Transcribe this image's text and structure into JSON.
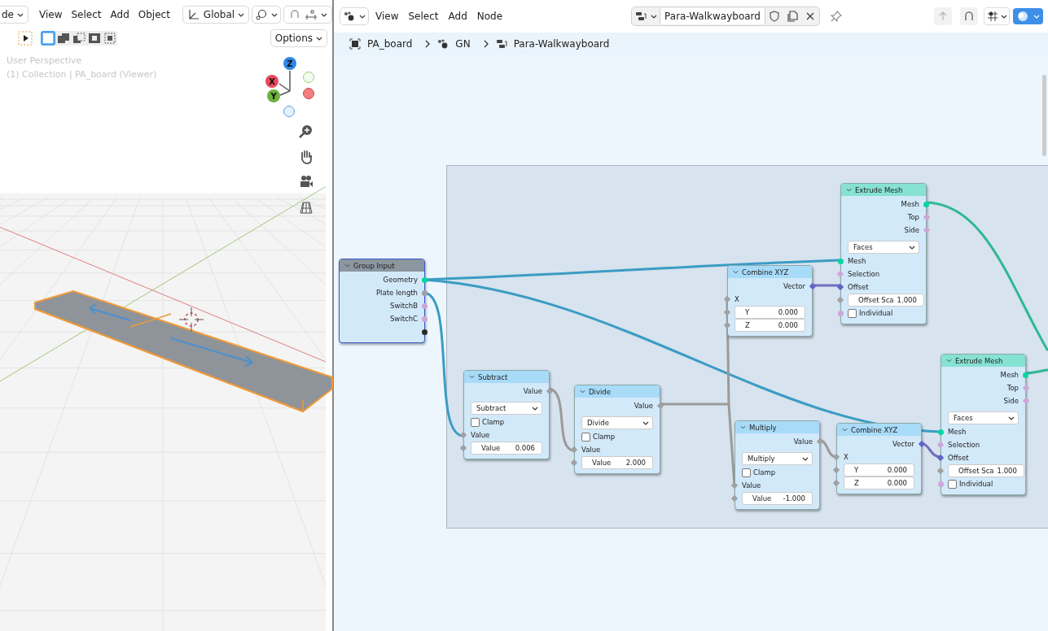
{
  "viewport": {
    "header": {
      "mode": "de",
      "menus": [
        "View",
        "Select",
        "Add",
        "Object"
      ],
      "orientation": "Global"
    },
    "options": "Options",
    "overlay": [
      "User Perspective",
      "(1) Collection | PA_board (Viewer)"
    ],
    "gizmo": {
      "z": "Z",
      "x": "X",
      "y": "Y"
    }
  },
  "node_editor": {
    "header": {
      "menus": [
        "View",
        "Select",
        "Add",
        "Node"
      ],
      "tree": "Para-Walkwayboard"
    },
    "breadcrumbs": [
      "PA_board",
      "GN",
      "Para-Walkwayboard"
    ],
    "nodes": [
      {
        "title": "Group Input",
        "color": "#8b969f",
        "selected": true,
        "rows": [
          {
            "kind": "output",
            "label": "Geometry",
            "color": "#00d6a3",
            "diamond": false
          },
          {
            "kind": "output",
            "label": "Plate length",
            "color": "#a1a1a1",
            "diamond": false
          },
          {
            "kind": "output",
            "label": "SwitchB",
            "color": "#cca6d6",
            "diamond": false
          },
          {
            "kind": "output",
            "label": "SwitchC",
            "color": "#cca6d6",
            "diamond": false
          },
          {
            "kind": "output",
            "color": "#2a2a2a",
            "diamond": false
          }
        ]
      },
      {
        "title": "Subtract",
        "color": "#a8dbf8",
        "selected": false,
        "rows": [
          {
            "kind": "output",
            "label": "Value",
            "color": "#a1a1a1",
            "diamond": true
          },
          {
            "kind": "dropdown",
            "value": "Subtract"
          },
          {
            "kind": "checkbox",
            "label": "Clamp",
            "checked": false
          },
          {
            "kind": "input",
            "label": "Value",
            "color": "#a1a1a1",
            "diamond": true
          },
          {
            "kind": "field",
            "label": "Value",
            "value": "0.006",
            "color": "#a1a1a1",
            "diamond": true
          }
        ]
      },
      {
        "title": "Divide",
        "color": "#a8dbf8",
        "selected": false,
        "rows": [
          {
            "kind": "output",
            "label": "Value",
            "color": "#a1a1a1",
            "diamond": true
          },
          {
            "kind": "dropdown",
            "value": "Divide"
          },
          {
            "kind": "checkbox",
            "label": "Clamp",
            "checked": false
          },
          {
            "kind": "input",
            "label": "Value",
            "color": "#a1a1a1",
            "diamond": true
          },
          {
            "kind": "field",
            "label": "Value",
            "value": "2.000",
            "color": "#a1a1a1",
            "diamond": true
          }
        ]
      },
      {
        "title": "Combine XYZ",
        "color": "#a8dbf8",
        "selected": false,
        "rows": [
          {
            "kind": "output",
            "label": "Vector",
            "color": "#6363c7",
            "diamond": true
          },
          {
            "kind": "input",
            "label": "X",
            "color": "#a1a1a1",
            "diamond": true
          },
          {
            "kind": "field",
            "label": "Y",
            "value": "0.000",
            "color": "#a1a1a1",
            "diamond": true
          },
          {
            "kind": "field",
            "label": "Z",
            "value": "0.000",
            "color": "#a1a1a1",
            "diamond": true
          }
        ]
      },
      {
        "title": "Extrude Mesh",
        "color": "#86e2d2",
        "selected": false,
        "rows": [
          {
            "kind": "output",
            "label": "Mesh",
            "color": "#00d6a3",
            "diamond": false
          },
          {
            "kind": "output",
            "label": "Top",
            "color": "#cca6d6",
            "diamond": true
          },
          {
            "kind": "output",
            "label": "Side",
            "color": "#cca6d6",
            "diamond": true
          },
          {
            "kind": "dropdown",
            "value": "Faces"
          },
          {
            "kind": "input",
            "label": "Mesh",
            "color": "#00d6a3",
            "diamond": false
          },
          {
            "kind": "input",
            "label": "Selection",
            "color": "#cca6d6",
            "diamond": true
          },
          {
            "kind": "input",
            "label": "Offset",
            "color": "#6363c7",
            "diamond": true
          },
          {
            "kind": "field",
            "label": "Offset Sca",
            "value": "1.000",
            "color": "#a1a1a1",
            "diamond": true
          },
          {
            "kind": "checkbox",
            "label": "Individual",
            "checked": false,
            "color": "#cca6d6",
            "diamond": false
          }
        ]
      },
      {
        "title": "Multiply",
        "color": "#a8dbf8",
        "selected": false,
        "rows": [
          {
            "kind": "output",
            "label": "Value",
            "color": "#a1a1a1",
            "diamond": true
          },
          {
            "kind": "dropdown",
            "value": "Multiply"
          },
          {
            "kind": "checkbox",
            "label": "Clamp",
            "checked": false
          },
          {
            "kind": "input",
            "label": "Value",
            "color": "#a1a1a1",
            "diamond": true
          },
          {
            "kind": "field",
            "label": "Value",
            "value": "-1.000",
            "color": "#a1a1a1",
            "diamond": true
          }
        ]
      },
      {
        "title": "Combine XYZ",
        "color": "#a8dbf8",
        "selected": false,
        "rows": [
          {
            "kind": "output",
            "label": "Vector",
            "color": "#6363c7",
            "diamond": true
          },
          {
            "kind": "input",
            "label": "X",
            "color": "#a1a1a1",
            "diamond": true
          },
          {
            "kind": "field",
            "label": "Y",
            "value": "0.000",
            "color": "#a1a1a1",
            "diamond": true
          },
          {
            "kind": "field",
            "label": "Z",
            "value": "0.000",
            "color": "#a1a1a1",
            "diamond": true
          }
        ]
      },
      {
        "title": "Extrude Mesh",
        "color": "#86e2d2",
        "selected": false,
        "rows": [
          {
            "kind": "output",
            "label": "Mesh",
            "color": "#00d6a3",
            "diamond": false
          },
          {
            "kind": "output",
            "label": "Top",
            "color": "#cca6d6",
            "diamond": true
          },
          {
            "kind": "output",
            "label": "Side",
            "color": "#cca6d6",
            "diamond": true
          },
          {
            "kind": "dropdown",
            "value": "Faces"
          },
          {
            "kind": "input",
            "label": "Mesh",
            "color": "#00d6a3",
            "diamond": false
          },
          {
            "kind": "input",
            "label": "Selection",
            "color": "#cca6d6",
            "diamond": true
          },
          {
            "kind": "input",
            "label": "Offset",
            "color": "#6363c7",
            "diamond": true
          },
          {
            "kind": "field",
            "label": "Offset Sca",
            "value": "1.000",
            "color": "#a1a1a1",
            "diamond": true
          },
          {
            "kind": "checkbox",
            "label": "Individual",
            "checked": false,
            "color": "#cca6d6",
            "diamond": false
          }
        ]
      }
    ]
  }
}
